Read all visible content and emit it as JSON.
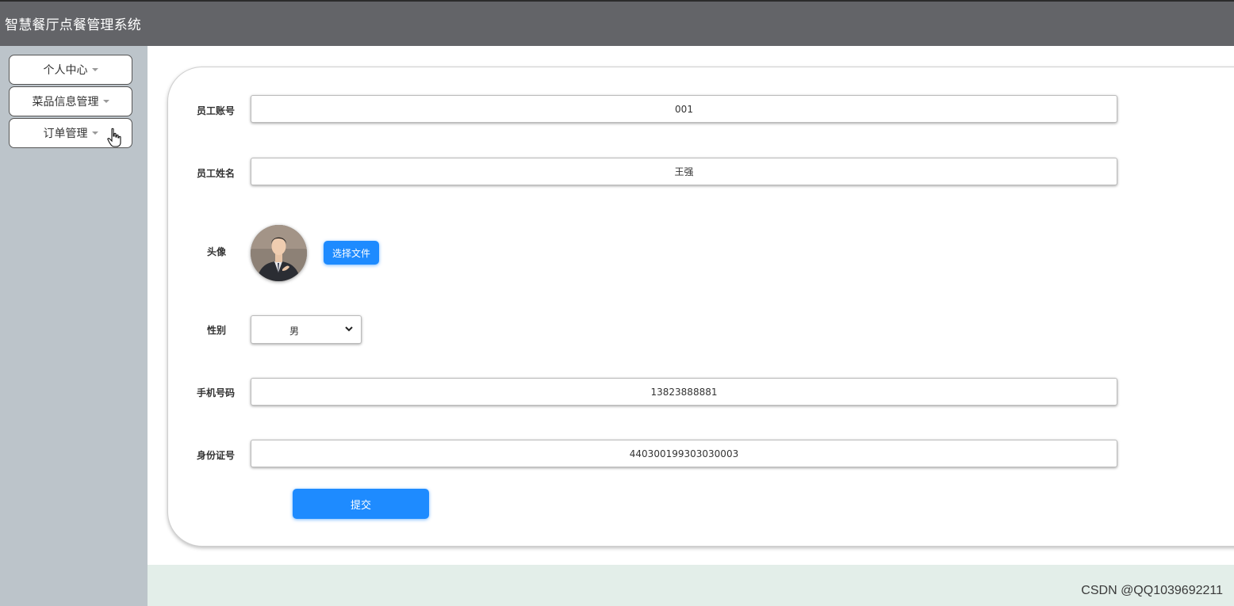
{
  "header": {
    "title": "智慧餐厅点餐管理系统"
  },
  "sidebar": {
    "items": [
      {
        "label": "个人中心"
      },
      {
        "label": "菜品信息管理"
      },
      {
        "label": "订单管理"
      }
    ]
  },
  "form": {
    "account_label": "员工账号",
    "account_value": "001",
    "name_label": "员工姓名",
    "name_value": "王强",
    "avatar_label": "头像",
    "file_button": "选择文件",
    "gender_label": "性别",
    "gender_value": "男",
    "phone_label": "手机号码",
    "phone_value": "13823888881",
    "id_label": "身份证号",
    "id_value": "440300199303030003",
    "submit_label": "提交"
  },
  "watermark": "CSDN @QQ1039692211",
  "colors": {
    "topbar": "#636468",
    "sidebar": "#bcc4ca",
    "primary": "#1e8bff",
    "footer": "#e3eee9"
  }
}
